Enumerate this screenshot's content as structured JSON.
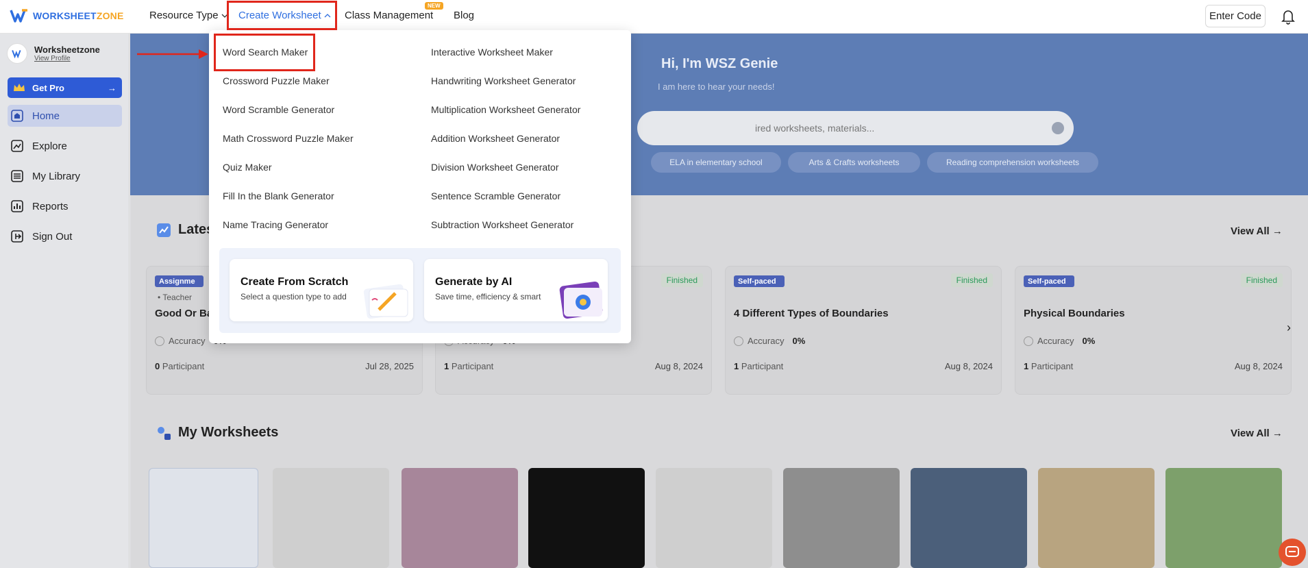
{
  "brand": {
    "logo_text_a": "WORKSHEET",
    "logo_text_b": "ZONE"
  },
  "nav": {
    "resource_type": "Resource Type",
    "create_worksheet": "Create Worksheet",
    "class_management": "Class Management",
    "new_badge": "NEW",
    "blog": "Blog",
    "enter_code": "Enter Code"
  },
  "sidebar": {
    "profile_name": "Worksheetzone",
    "profile_link": "View Profile",
    "get_pro": "Get Pro",
    "items": [
      {
        "label": "Home"
      },
      {
        "label": "Explore"
      },
      {
        "label": "My Library"
      },
      {
        "label": "Reports"
      },
      {
        "label": "Sign Out"
      }
    ]
  },
  "hero": {
    "title": "Hi, I'm WSZ Genie",
    "subtitle": "I am here to hear your needs!",
    "search_placeholder": "ired worksheets, materials...",
    "chips": [
      "ELA in elementary school",
      "Arts & Crafts worksheets",
      "Reading comprehension worksheets"
    ]
  },
  "latest": {
    "title": "Lates",
    "view_all": "View All",
    "cards": [
      {
        "tag": "Assignme",
        "teacher": "Teacher",
        "title": "Good Or Bac",
        "accuracy_label": "Accuracy",
        "accuracy": "0%",
        "participants": "0",
        "participant_label": "Participant",
        "date": "Jul 28, 2025"
      },
      {
        "tag": "",
        "status": "Finished",
        "title": "",
        "accuracy_label": "Accuracy",
        "accuracy": "0%",
        "participants": "1",
        "participant_label": "Participant",
        "date": "Aug 8, 2024"
      },
      {
        "tag": "Self-paced",
        "status": "Finished",
        "title": "4 Different Types of Boundaries",
        "accuracy_label": "Accuracy",
        "accuracy": "0%",
        "participants": "1",
        "participant_label": "Participant",
        "date": "Aug 8, 2024"
      },
      {
        "tag": "Self-paced",
        "status": "Finished",
        "title": "Physical Boundaries",
        "accuracy_label": "Accuracy",
        "accuracy": "0%",
        "participants": "1",
        "participant_label": "Participant",
        "date": "Aug 8, 2024"
      }
    ]
  },
  "my_worksheets": {
    "title": "My Worksheets",
    "view_all": "View All"
  },
  "dropdown": {
    "left": [
      "Word Search Maker",
      "Crossword Puzzle Maker",
      "Word Scramble Generator",
      "Math Crossword Puzzle Maker",
      "Quiz Maker",
      "Fill In the Blank Generator",
      "Name Tracing Generator"
    ],
    "right": [
      "Interactive Worksheet Maker",
      "Handwriting Worksheet Generator",
      "Multiplication Worksheet Generator",
      "Addition Worksheet Generator",
      "Division Worksheet Generator",
      "Sentence Scramble Generator",
      "Subtraction Worksheet Generator"
    ],
    "scratch_title": "Create From Scratch",
    "scratch_sub": "Select a question type to add",
    "ai_title": "Generate by AI",
    "ai_sub": "Save time, efficiency & smart"
  },
  "colors": {
    "accent": "#2f6fe0",
    "annotation": "#e0261b",
    "hero": "#5d7db5"
  }
}
